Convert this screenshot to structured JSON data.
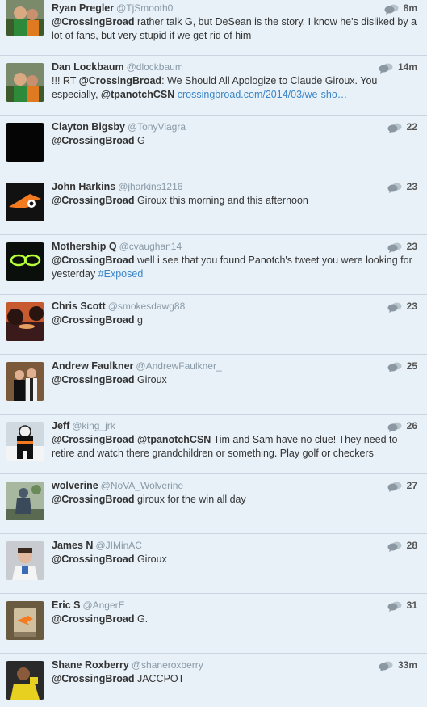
{
  "tweets": [
    {
      "name": "Ryan Pregler",
      "handle": "@TjSmooth0",
      "time": "8m",
      "avatar": "avatar-photo",
      "segments": [
        {
          "type": "mention",
          "text": "@CrossingBroad"
        },
        {
          "type": "text",
          "text": " rather talk G, but DeSean is the story. I know he's disliked by a lot of fans, but very stupid if we get rid of him"
        }
      ]
    },
    {
      "name": "Dan Lockbaum",
      "handle": "@dlockbaum",
      "time": "14m",
      "avatar": "avatar-photo",
      "segments": [
        {
          "type": "text",
          "text": "!!! RT "
        },
        {
          "type": "mention",
          "text": "@CrossingBroad"
        },
        {
          "type": "text",
          "text": ": We Should All Apologize to Claude Giroux. You especially, "
        },
        {
          "type": "mention",
          "text": "@tpanotchCSN"
        },
        {
          "type": "text",
          "text": " "
        },
        {
          "type": "link",
          "text": "crossingbroad.com/2014/03/we-sho…"
        }
      ]
    },
    {
      "name": "Clayton Bigsby",
      "handle": "@TonyViagra",
      "time": "22",
      "avatar": "avatar-black",
      "segments": [
        {
          "type": "mention",
          "text": "@CrossingBroad"
        },
        {
          "type": "text",
          "text": " G"
        }
      ]
    },
    {
      "name": "John Harkins",
      "handle": "@jharkins1216",
      "time": "23",
      "avatar": "avatar-flyers-logo",
      "segments": [
        {
          "type": "mention",
          "text": "@CrossingBroad"
        },
        {
          "type": "text",
          "text": " Giroux this morning and this afternoon"
        }
      ]
    },
    {
      "name": "Mothership Q",
      "handle": "@cvaughan14",
      "time": "23",
      "avatar": "avatar-glow-glasses",
      "segments": [
        {
          "type": "mention",
          "text": "@CrossingBroad"
        },
        {
          "type": "text",
          "text": " well i see that you found Panotch's tweet you were looking for yesterday "
        },
        {
          "type": "hashtag",
          "text": "#Exposed"
        }
      ]
    },
    {
      "name": "Chris Scott",
      "handle": "@smokesdawg88",
      "time": "23",
      "avatar": "avatar-sunset",
      "segments": [
        {
          "type": "mention",
          "text": "@CrossingBroad"
        },
        {
          "type": "text",
          "text": " g"
        }
      ]
    },
    {
      "name": "Andrew Faulkner",
      "handle": "@AndrewFaulkner_",
      "time": "25",
      "avatar": "avatar-couple",
      "segments": [
        {
          "type": "mention",
          "text": "@CrossingBroad"
        },
        {
          "type": "text",
          "text": " Giroux"
        }
      ]
    },
    {
      "name": "Jeff",
      "handle": "@king_jrk",
      "time": "26",
      "avatar": "avatar-hockey",
      "segments": [
        {
          "type": "mention",
          "text": "@CrossingBroad"
        },
        {
          "type": "text",
          "text": " "
        },
        {
          "type": "mention",
          "text": "@tpanotchCSN"
        },
        {
          "type": "text",
          "text": " Tim and Sam have no clue! They need to retire and watch there grandchildren or something. Play golf or checkers"
        }
      ]
    },
    {
      "name": "wolverine",
      "handle": "@NoVA_Wolverine",
      "time": "27",
      "avatar": "avatar-statue",
      "segments": [
        {
          "type": "mention",
          "text": "@CrossingBroad"
        },
        {
          "type": "text",
          "text": " giroux for the win all day"
        }
      ]
    },
    {
      "name": "James N",
      "handle": "@JIMinAC",
      "time": "28",
      "avatar": "avatar-man",
      "segments": [
        {
          "type": "mention",
          "text": "@CrossingBroad"
        },
        {
          "type": "text",
          "text": " Giroux"
        }
      ]
    },
    {
      "name": "Eric S",
      "handle": "@AngerE",
      "time": "31",
      "avatar": "avatar-flyers-cup",
      "segments": [
        {
          "type": "mention",
          "text": "@CrossingBroad"
        },
        {
          "type": "text",
          "text": " G."
        }
      ]
    },
    {
      "name": "Shane Roxberry",
      "handle": "@shaneroxberry",
      "time": "33m",
      "avatar": "avatar-yellow-shirt",
      "segments": [
        {
          "type": "mention",
          "text": "@CrossingBroad"
        },
        {
          "type": "text",
          "text": " JACCPOT"
        }
      ]
    }
  ],
  "icons": {
    "reply": "conversation-bubble-icon"
  },
  "colors": {
    "background": "#e8f1f8",
    "link": "#3a85c8",
    "divider": "#c9d6e1"
  }
}
